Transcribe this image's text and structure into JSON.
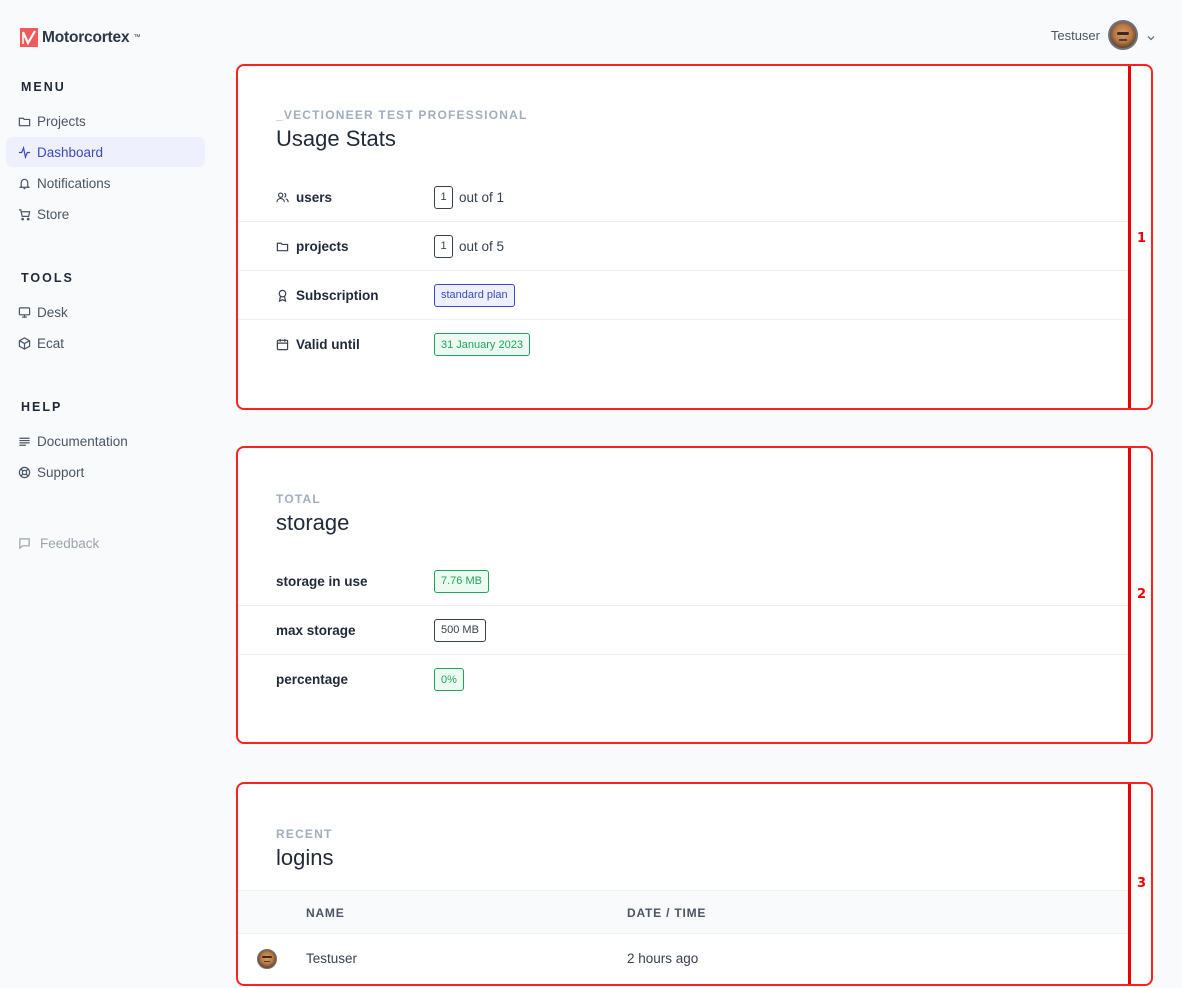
{
  "brand": {
    "name": "Motorcortex",
    "tm": "™",
    "color": "#f05a5a"
  },
  "user": {
    "name": "Testuser",
    "avatar_icon": "user-avatar"
  },
  "sidebar": {
    "sections": [
      {
        "title": "MENU",
        "items": [
          {
            "label": "Projects",
            "icon": "folder-icon"
          },
          {
            "label": "Dashboard",
            "icon": "activity-icon",
            "active": true
          },
          {
            "label": "Notifications",
            "icon": "bell-icon"
          },
          {
            "label": "Store",
            "icon": "cart-icon"
          }
        ]
      },
      {
        "title": "TOOLS",
        "items": [
          {
            "label": "Desk",
            "icon": "monitor-icon"
          },
          {
            "label": "Ecat",
            "icon": "cube-icon"
          }
        ]
      },
      {
        "title": "HELP",
        "items": [
          {
            "label": "Documentation",
            "icon": "text-lines-icon"
          },
          {
            "label": "Support",
            "icon": "lifebuoy-icon"
          }
        ]
      }
    ],
    "feedback": {
      "label": "Feedback",
      "icon": "message-icon"
    }
  },
  "usage": {
    "annotation": "1",
    "eyebrow": "_VECTIONEER TEST PROFESSIONAL",
    "title": "Usage Stats",
    "rows": [
      {
        "label": "users",
        "icon": "users-icon",
        "count": "1",
        "suffix": "out of 1"
      },
      {
        "label": "projects",
        "icon": "folder-icon",
        "count": "1",
        "suffix": "out of 5"
      },
      {
        "label": "Subscription",
        "icon": "award-icon",
        "value": "standard plan"
      },
      {
        "label": "Valid until",
        "icon": "calendar-icon",
        "value": "31 January 2023"
      }
    ]
  },
  "storage": {
    "annotation": "2",
    "eyebrow": "TOTAL",
    "title": "storage",
    "rows": [
      {
        "label": "storage in use",
        "value": "7.76 MB"
      },
      {
        "label": "max storage",
        "value": "500 MB"
      },
      {
        "label": "percentage",
        "value": "0%"
      }
    ]
  },
  "logins": {
    "annotation": "3",
    "eyebrow": "RECENT",
    "title": "logins",
    "columns": [
      "NAME",
      "DATE / TIME"
    ],
    "rows": [
      {
        "name": "Testuser",
        "time": "2 hours ago"
      }
    ]
  }
}
